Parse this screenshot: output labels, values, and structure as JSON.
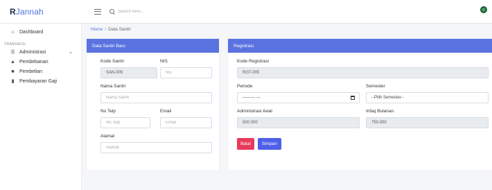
{
  "brand": {
    "bold": "R",
    "rest": "Jannah"
  },
  "search": {
    "placeholder": "Search here..."
  },
  "sidebar": {
    "dashboard": "Dashboard",
    "heading": "TRANSAKSI",
    "items": [
      {
        "label": "Administrasi",
        "icon": "list-icon"
      },
      {
        "label": "Pembebanan",
        "icon": "ship-icon"
      },
      {
        "label": "Pembelian",
        "icon": "truck-icon"
      },
      {
        "label": "Pembayaran Gaji",
        "icon": "trash-icon"
      }
    ],
    "chevron": "⌄"
  },
  "breadcrumb": {
    "home": "Home",
    "sep": "/",
    "current": "Data Santri"
  },
  "santri_card": {
    "title": "Data Santri Baru",
    "kode_label": "Kode Santri",
    "kode_value": "SAN-005",
    "nis_label": "NIS",
    "nis_placeholder": "Nis",
    "nama_label": "Nama Santri",
    "nama_placeholder": "Nama Santri",
    "telp_label": "No Telp",
    "telp_placeholder": "No Telp",
    "email_label": "Email",
    "email_placeholder": "Email",
    "alamat_label": "Alamat",
    "alamat_placeholder": "Alamat"
  },
  "registrasi_card": {
    "title": "Registrasi",
    "kode_label": "Kode Registrasi",
    "kode_value": "RGT-005",
    "periode_label": "Periode",
    "periode_value": "——— —",
    "semester_label": "Semester",
    "semester_value": "--Pilih Semester--",
    "admin_label": "Administrasi Awal",
    "admin_value": "500.000",
    "infaq_label": "Infaq Bulanan",
    "infaq_value": "750.000",
    "cancel_label": "Batal",
    "save_label": "Simpan"
  },
  "colors": {
    "header": "#5a73e0",
    "cancel": "#e83a5b",
    "save": "#4e60e8",
    "brand": "#4e73df"
  }
}
